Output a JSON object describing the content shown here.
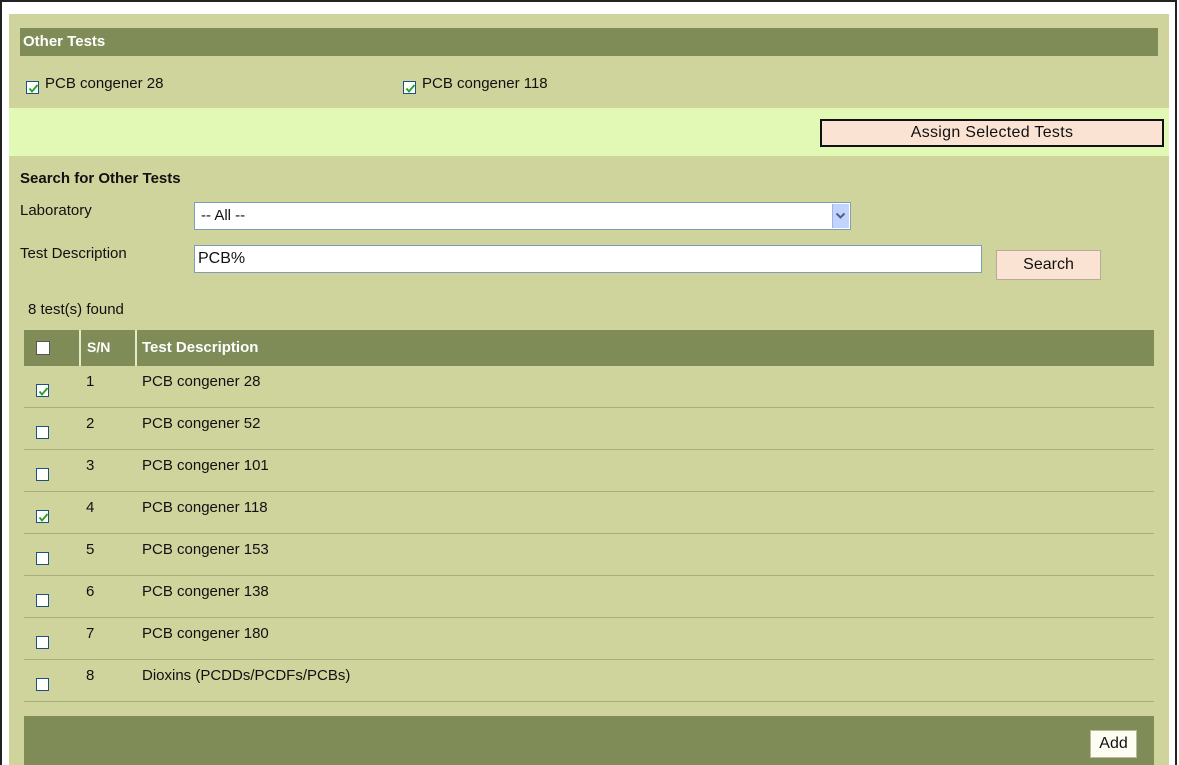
{
  "other_tests": {
    "title": "Other Tests",
    "selected": [
      {
        "label": "PCB congener 28",
        "checked": true
      },
      {
        "label": "PCB congener 118",
        "checked": true
      }
    ]
  },
  "assign_button": "Assign Selected Tests",
  "search": {
    "title": "Search for Other Tests",
    "laboratory_label": "Laboratory",
    "laboratory_value": "-- All --",
    "test_description_label": "Test Description",
    "test_description_value": "PCB%",
    "search_button": "Search"
  },
  "results": {
    "count_text": "8 test(s) found",
    "columns": {
      "sn": "S/N",
      "description": "Test Description"
    },
    "select_all_checked": false,
    "rows": [
      {
        "sn": "1",
        "description": "PCB congener 28",
        "checked": true
      },
      {
        "sn": "2",
        "description": "PCB congener 52",
        "checked": false
      },
      {
        "sn": "3",
        "description": "PCB congener 101",
        "checked": false
      },
      {
        "sn": "4",
        "description": "PCB congener 118",
        "checked": true
      },
      {
        "sn": "5",
        "description": "PCB congener 153",
        "checked": false
      },
      {
        "sn": "6",
        "description": "PCB congener 138",
        "checked": false
      },
      {
        "sn": "7",
        "description": "PCB congener 180",
        "checked": false
      },
      {
        "sn": "8",
        "description": "Dioxins (PCDDs/PCDFs/PCBs)",
        "checked": false
      }
    ]
  },
  "add_button": "Add",
  "colors": {
    "panel": "#cfd39c",
    "header": "#7f8c57",
    "assign_bar": "#e2f9b5",
    "button": "#fbe3d3",
    "check": "#21a121"
  }
}
